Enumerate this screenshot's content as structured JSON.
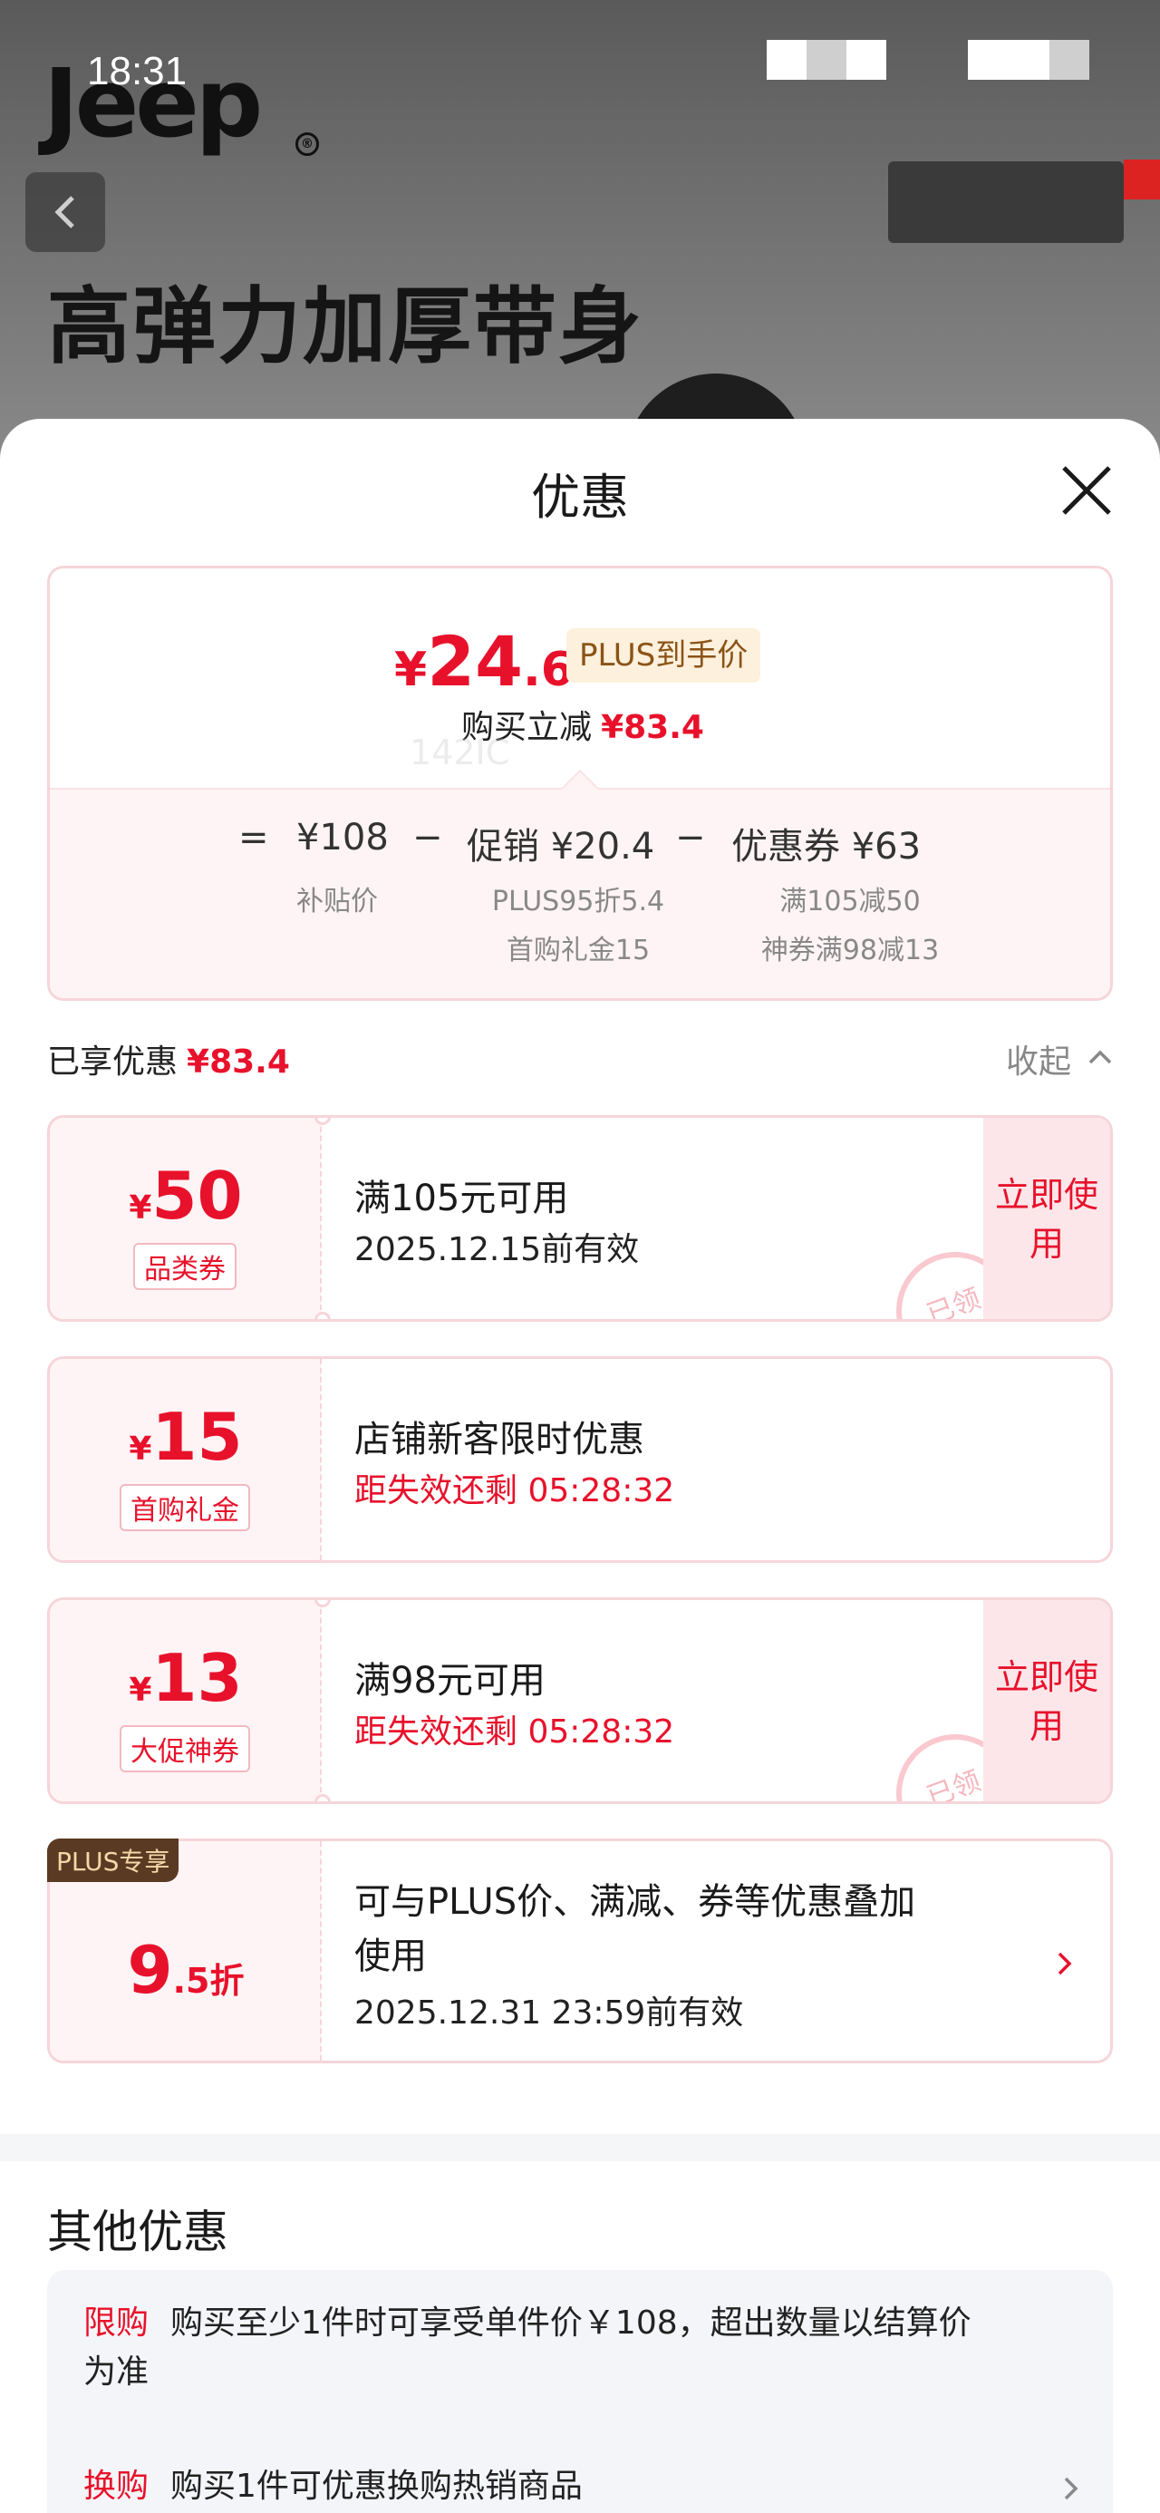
{
  "status_bar": {
    "time": "18:31"
  },
  "background_page": {
    "brand_logo": "Jeep",
    "brand_registered": "®",
    "product_title": "高弹力加厚带身"
  },
  "sheet": {
    "title": "优惠",
    "summary": {
      "final_price_symbol": "¥",
      "final_price_int": "24",
      "final_price_dec": ".6",
      "price_tag": "PLUS到手价",
      "instant_label": "购买立减",
      "instant_amount": "¥83.4",
      "equals": "=",
      "minus": "−",
      "base_price": "¥108",
      "base_price_label": "补贴价",
      "promo_label": "促销",
      "promo_amount": "¥20.4",
      "promo_detail_1": "PLUS95折5.4",
      "promo_detail_2": "首购礼金15",
      "coupon_label": "优惠券",
      "coupon_amount": "¥63",
      "coupon_detail_1": "满105减50",
      "coupon_detail_2": "神券满98减13"
    },
    "enjoyed": {
      "label": "已享优惠",
      "amount": "¥83.4",
      "collapse_label": "收起"
    },
    "coupons": [
      {
        "symbol": "¥",
        "amount": "50",
        "tag": "品类券",
        "main": "满105元可用",
        "sub": "2025.12.15前有效",
        "action": "立即使用",
        "stamp": "已领"
      },
      {
        "symbol": "¥",
        "amount": "15",
        "tag": "首购礼金",
        "main": "店铺新客限时优惠",
        "sub": "距失效还剩 05:28:32"
      },
      {
        "symbol": "¥",
        "amount": "13",
        "tag": "大促神券",
        "main": "满98元可用",
        "sub": "距失效还剩 05:28:32",
        "action": "立即使用",
        "stamp": "已领"
      }
    ],
    "plus_coupon": {
      "badge": "PLUS专享",
      "discount_big": "9",
      "discount_small": ".5折",
      "main_line1": "可与PLUS价、满减、券等优惠叠加",
      "main_line2": "使用",
      "sub": "2025.12.31 23:59前有效"
    },
    "other": {
      "title": "其他优惠",
      "rows": [
        {
          "label": "限购",
          "text_line1": "购买至少1件时可享受单件价￥108，超出数量以结算价",
          "text_line2": "为准"
        },
        {
          "label": "换购",
          "text_line1": "购买1件可优惠换购热销商品"
        }
      ]
    },
    "watermark": "142IC"
  }
}
